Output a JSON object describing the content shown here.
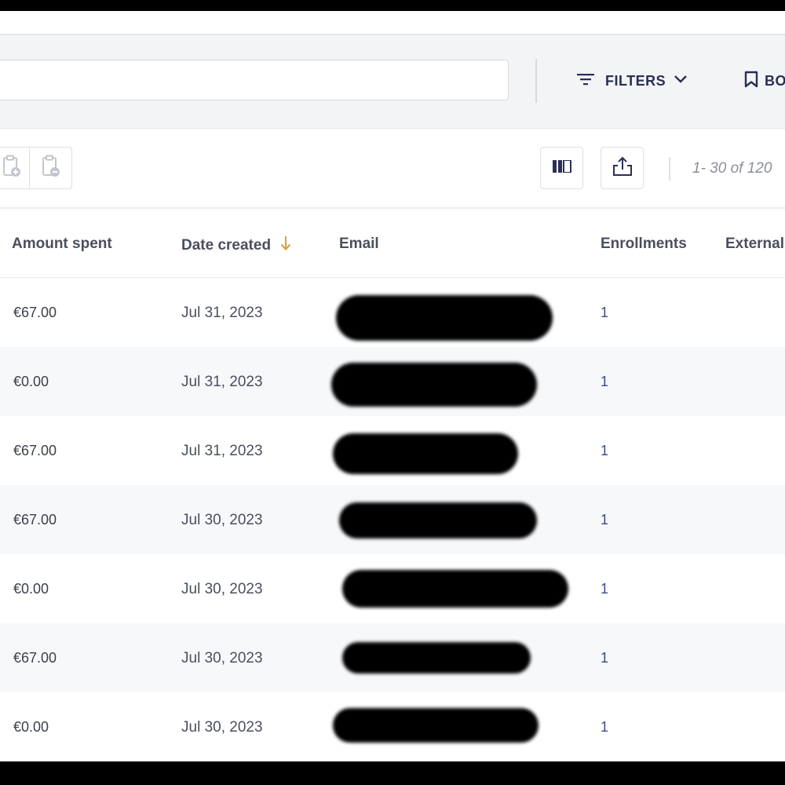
{
  "search": {
    "value": "",
    "placeholder": ""
  },
  "filters_label": "FILTERS",
  "bookmarks_label": "BO",
  "pagination": "1- 30 of 120",
  "columns": {
    "amount": "Amount spent",
    "date": "Date created",
    "email": "Email",
    "enrollments": "Enrollments",
    "external": "External"
  },
  "icons": {
    "filter": "filter-lines-icon",
    "chevron": "chevron-down-icon",
    "bookmark": "bookmark-icon",
    "add": "clipboard-add-icon",
    "remove": "clipboard-remove-icon",
    "columns": "columns-icon",
    "export": "export-icon",
    "sort": "arrow-down-icon"
  },
  "colors": {
    "accent_navy": "#2a2f55",
    "link": "#3f4a8c",
    "sort_arrow": "#d9a441"
  },
  "rows": [
    {
      "amount": "€67.00",
      "date": "Jul 31, 2023",
      "email": "[redacted]",
      "enrollments": "1"
    },
    {
      "amount": "€0.00",
      "date": "Jul 31, 2023",
      "email": "[redacted]",
      "enrollments": "1"
    },
    {
      "amount": "€67.00",
      "date": "Jul 31, 2023",
      "email": "[redacted]",
      "enrollments": "1"
    },
    {
      "amount": "€67.00",
      "date": "Jul 30, 2023",
      "email": "[redacted]",
      "enrollments": "1"
    },
    {
      "amount": "€0.00",
      "date": "Jul 30, 2023",
      "email": "[redacted]",
      "enrollments": "1"
    },
    {
      "amount": "€67.00",
      "date": "Jul 30, 2023",
      "email": "[redacted]",
      "enrollments": "1"
    },
    {
      "amount": "€0.00",
      "date": "Jul 30, 2023",
      "email": "[redacted]",
      "enrollments": "1"
    }
  ]
}
